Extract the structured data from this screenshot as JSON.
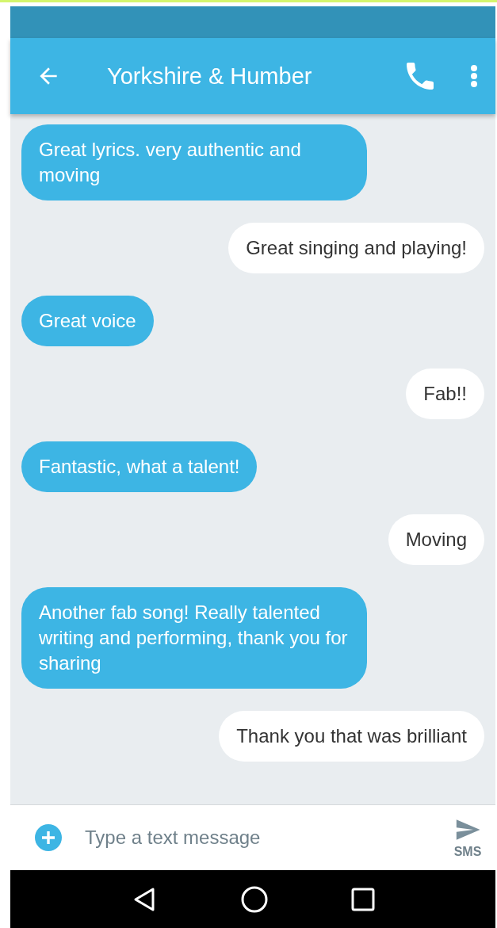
{
  "app_bar": {
    "title": "Yorkshire & Humber"
  },
  "messages": [
    {
      "kind": "incoming",
      "text": "Great lyrics. very authentic and moving"
    },
    {
      "kind": "outgoing",
      "text": "Great singing and playing!"
    },
    {
      "kind": "incoming",
      "text": "Great voice"
    },
    {
      "kind": "outgoing",
      "text": "Fab!!"
    },
    {
      "kind": "incoming",
      "text": "Fantastic, what a talent!"
    },
    {
      "kind": "outgoing",
      "text": "Moving"
    },
    {
      "kind": "incoming",
      "text": "Another fab song! Really talented writing and performing, thank you for sharing"
    },
    {
      "kind": "outgoing",
      "text": "Thank you that was brilliant"
    }
  ],
  "composer": {
    "placeholder": "Type a text message",
    "send_label": "SMS"
  }
}
